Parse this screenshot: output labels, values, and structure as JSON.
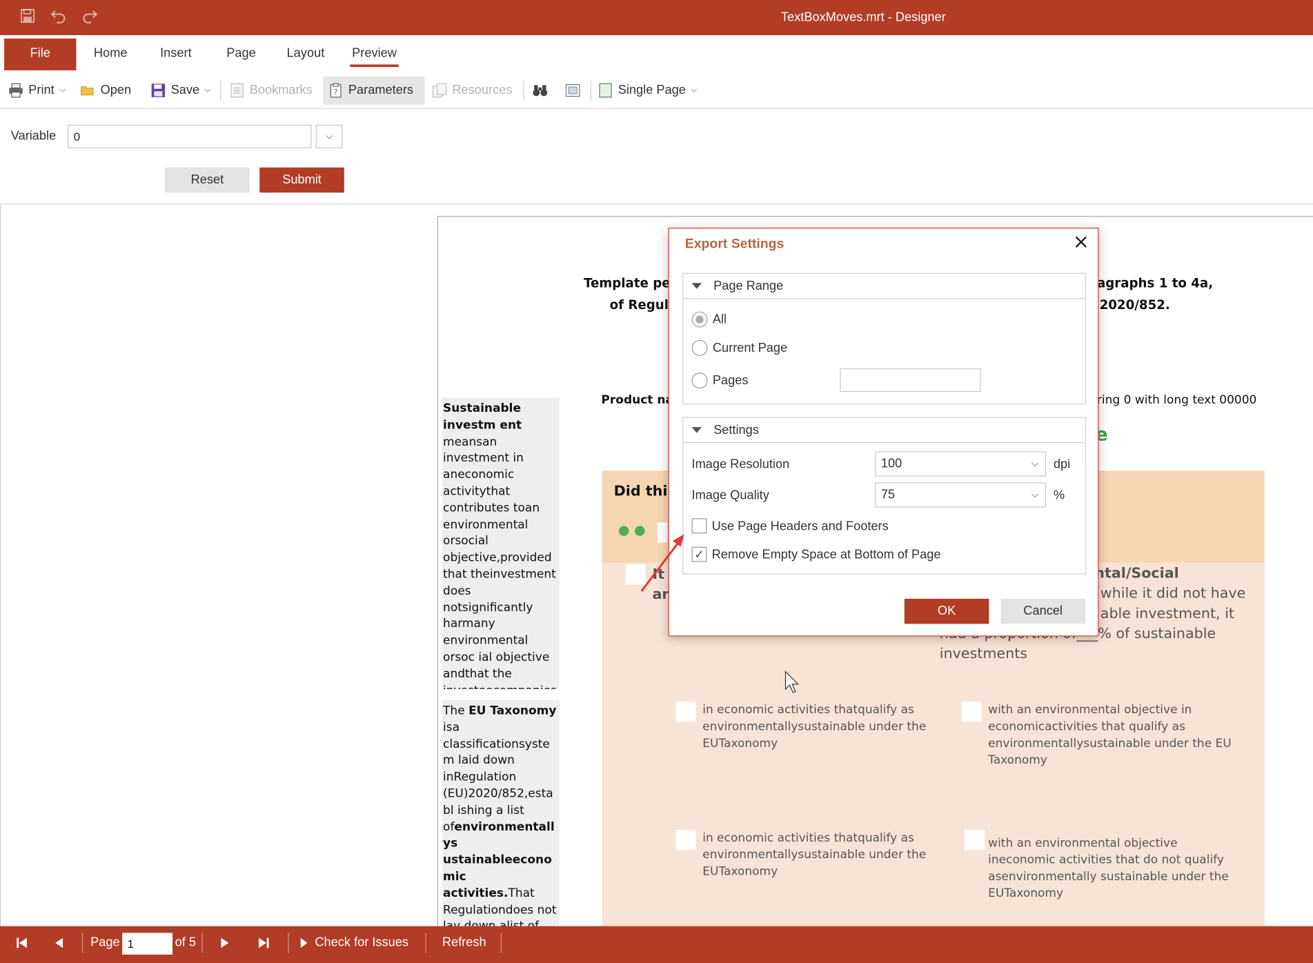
{
  "window": {
    "title": "TextBoxMoves.mrt - Designer",
    "accent_color": "#b23c25",
    "quick_access": [
      {
        "name": "save-icon",
        "glyph": "💾"
      },
      {
        "name": "undo-icon",
        "glyph": "↶"
      },
      {
        "name": "redo-icon",
        "glyph": "↷"
      }
    ]
  },
  "tabs": {
    "file": "File",
    "home": "Home",
    "insert": "Insert",
    "page": "Page",
    "layout": "Layout",
    "preview": "Preview",
    "active": "Preview"
  },
  "toolbar": {
    "print": "Print",
    "open": "Open",
    "save": "Save",
    "bookmarks": "Bookmarks",
    "parameters": "Parameters",
    "resources": "Resources",
    "view_mode": "Single Page"
  },
  "parameters": {
    "variable_label": "Variable",
    "variable_value": "0",
    "reset_label": "Reset",
    "submit_label": "Submit"
  },
  "report": {
    "header_line1_left": "Template peri",
    "header_line1_right": "agraphs 1 to 4a,",
    "header_line2_left": "of Regula",
    "header_line2_right": "2020/852.",
    "product_left": "Product nan",
    "product_right": "ring 0 with long text 00000",
    "green_letter": "e",
    "banner_title": "Did this",
    "sidebox1_b1": "Sustainable investm ent",
    "sidebox1_text": " meansan investment in aneconomic activitythat contributes toan environmental orsocial objective,provided that theinvestment does notsignificantly harmany environmental orsoc ial objective andthat the investeecompanies followgood governancepractices",
    "sidebox2_t1": "The ",
    "sidebox2_b1": "EU Taxonomy",
    "sidebox2_t2": " isa classificationsystem laid down inRegulation (EU)2020/852,establ ishing a list of",
    "sidebox2_b2": "environmentallys ustainableeconomic activities.",
    "sidebox2_t3": "That Regulationdoes not lay down alist of sociallysustainableec onomic",
    "left_it": "It r",
    "left_an": "an",
    "right_heading": "ntal/Social",
    "right_l1": "while it did not have",
    "right_l2": "able investment, it",
    "right_l3": "had a proportion of___% of sustainable",
    "right_l4": "investments",
    "item1": "in economic activities thatqualify as environmentallysustainable under the EUTaxonomy",
    "item2": "with an environmental objective in economicactivities that qualify as environmentallysustainable under the EU Taxonomy",
    "item3": "in economic activities thatqualify as environmentallysustainable under the EUTaxonomy",
    "item4": "with an environmental objective ineconomic activities that do not qualify asenvironmentally sustainable under the EUTaxonomy"
  },
  "dialog": {
    "title": "Export Settings",
    "page_range": {
      "header": "Page Range",
      "all": "All",
      "current": "Current Page",
      "pages": "Pages",
      "selected": "All",
      "pages_value": ""
    },
    "settings": {
      "header": "Settings",
      "resolution_label": "Image Resolution",
      "resolution_value": "100",
      "resolution_unit": "dpi",
      "quality_label": "Image Quality",
      "quality_value": "75",
      "quality_unit": "%",
      "headers_footers_label": "Use Page Headers and Footers",
      "headers_footers_checked": false,
      "remove_space_label": "Remove Empty Space at Bottom of Page",
      "remove_space_checked": true
    },
    "ok_label": "OK",
    "cancel_label": "Cancel"
  },
  "statusbar": {
    "page_label": "Page",
    "page_value": "1",
    "of_label": "of 5",
    "check_issues": "Check for Issues",
    "refresh": "Refresh"
  }
}
